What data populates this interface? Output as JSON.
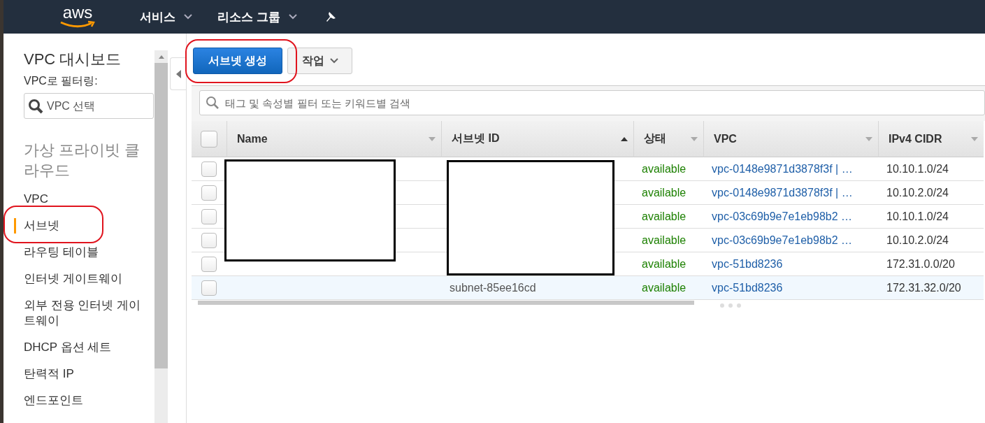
{
  "top_nav": {
    "logo": "aws",
    "menus": [
      {
        "label": "서비스"
      },
      {
        "label": "리소스 그룹"
      }
    ]
  },
  "sidebar": {
    "title": "VPC 대시보드",
    "filter_label": "VPC로 필터링:",
    "filter_placeholder": "VPC 선택",
    "section": "가상 프라이빗 클라우드",
    "items": [
      {
        "label": "VPC",
        "selected": false
      },
      {
        "label": "서브넷",
        "selected": true
      },
      {
        "label": "라우팅 테이블",
        "selected": false
      },
      {
        "label": "인터넷 게이트웨이",
        "selected": false
      },
      {
        "label": "외부 전용 인터넷 게이트웨이",
        "selected": false
      },
      {
        "label": "DHCP 옵션 세트",
        "selected": false
      },
      {
        "label": "탄력적 IP",
        "selected": false
      },
      {
        "label": "엔드포인트",
        "selected": false
      }
    ]
  },
  "toolbar": {
    "create_button": "서브넷 생성",
    "actions_button": "작업"
  },
  "search": {
    "placeholder": "태그 및 속성별 필터 또는 키워드별 검색"
  },
  "table": {
    "all_checked": false,
    "columns": [
      {
        "label": "Name",
        "sorted": false
      },
      {
        "label": "서브넷 ID",
        "sorted": true
      },
      {
        "label": "상태",
        "sorted": false
      },
      {
        "label": "VPC",
        "sorted": false
      },
      {
        "label": "IPv4 CIDR",
        "sorted": false
      }
    ],
    "rows": [
      {
        "checked": false,
        "highlighted": false,
        "status": "available",
        "vpc": "vpc-0148e9871d3878f3f | …",
        "cidr": "10.10.1.0/24"
      },
      {
        "checked": false,
        "highlighted": false,
        "status": "available",
        "vpc": "vpc-0148e9871d3878f3f | …",
        "cidr": "10.10.2.0/24"
      },
      {
        "checked": false,
        "highlighted": false,
        "status": "available",
        "vpc": "vpc-03c69b9e7e1eb98b2 …",
        "cidr": "10.10.1.0/24"
      },
      {
        "checked": false,
        "highlighted": false,
        "status": "available",
        "vpc": "vpc-03c69b9e7e1eb98b2 …",
        "cidr": "10.10.2.0/24"
      },
      {
        "checked": false,
        "highlighted": false,
        "status": "available",
        "vpc": "vpc-51bd8236",
        "cidr": "172.31.0.0/20"
      },
      {
        "checked": false,
        "highlighted": true,
        "subnet_id": "subnet-85ee16cd",
        "status": "available",
        "vpc": "vpc-51bd8236",
        "cidr": "172.31.32.0/20"
      }
    ]
  }
}
